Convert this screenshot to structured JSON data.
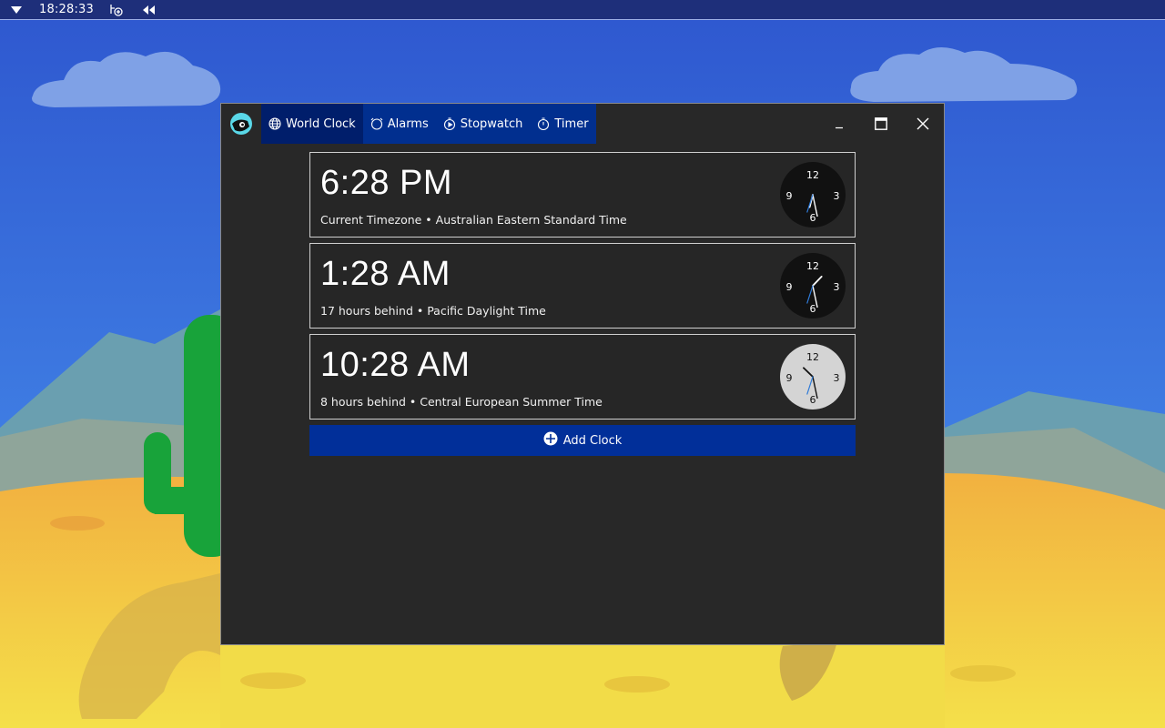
{
  "panel": {
    "clock": "18:28:33",
    "icons": [
      "menu-triangle-icon",
      "network-icon",
      "volume-icon"
    ]
  },
  "window": {
    "tabs": [
      {
        "label": "World Clock",
        "icon": "globe-icon",
        "active": true
      },
      {
        "label": "Alarms",
        "icon": "alarm-icon",
        "active": false
      },
      {
        "label": "Stopwatch",
        "icon": "stopwatch-icon",
        "active": false
      },
      {
        "label": "Timer",
        "icon": "timer-icon",
        "active": false
      }
    ],
    "controls": [
      "minimize",
      "maximize",
      "close"
    ]
  },
  "clocks": [
    {
      "time": "6:28 PM",
      "desc": "Current Timezone • Australian Eastern Standard Time",
      "face": "dark",
      "hour": 18,
      "minute": 28,
      "second": 33
    },
    {
      "time": "1:28 AM",
      "desc": "17 hours behind • Pacific Daylight Time",
      "face": "dark",
      "hour": 1,
      "minute": 28,
      "second": 33
    },
    {
      "time": "10:28 AM",
      "desc": "8 hours behind • Central European Summer Time",
      "face": "light",
      "hour": 10,
      "minute": 28,
      "second": 33
    }
  ],
  "dial_numbers": [
    "12",
    "3",
    "6",
    "9"
  ],
  "add_button": {
    "label": "Add Clock"
  },
  "colors": {
    "accent": "#012f99",
    "window_bg": "#282828",
    "second_hand": "#2f7bd8"
  }
}
